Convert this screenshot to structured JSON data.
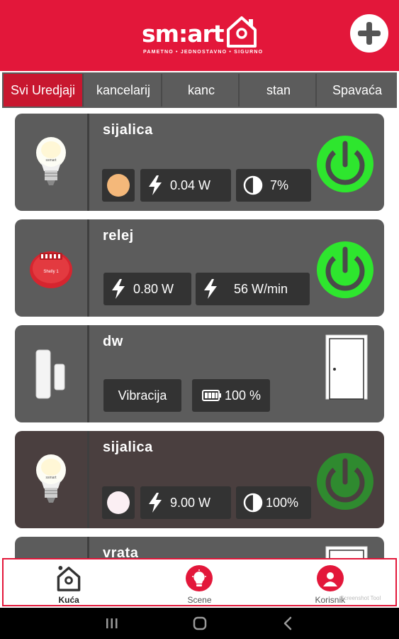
{
  "app": {
    "logo_text": "sm:art",
    "logo_tagline": "PAMETNO • JEDNOSTAVNO • SIGURNO",
    "add_icon": "plus-icon"
  },
  "tabs": [
    {
      "label": "Svi Uredjaji",
      "active": true
    },
    {
      "label": "kancelarij",
      "active": false
    },
    {
      "label": "kanc",
      "active": false
    },
    {
      "label": "stan",
      "active": false
    },
    {
      "label": "Spavaća",
      "active": false
    }
  ],
  "devices": [
    {
      "name": "sijalica",
      "icon": "light-bulb-icon",
      "color": "#f4b87a",
      "power": "0.04 W",
      "brightness": "7%",
      "state": "on",
      "power_color": "#2ee62e"
    },
    {
      "name": "relej",
      "icon": "relay-module-icon",
      "power": "0.80 W",
      "energy": "56 W/min",
      "state": "on",
      "power_color": "#2ee62e"
    },
    {
      "name": "dw",
      "icon": "door-window-sensor-icon",
      "vibration": "Vibracija",
      "battery": "100 %",
      "door_icon": "door-closed-icon"
    },
    {
      "name": "sijalica",
      "icon": "light-bulb-icon",
      "color": "#fbeff3",
      "power": "9.00 W",
      "brightness": "100%",
      "state": "on-dim",
      "power_color": "#2f8a2f"
    },
    {
      "name": "vrata",
      "icon": "door-window-sensor-icon"
    }
  ],
  "bottom_nav": [
    {
      "label": "Kuća",
      "icon": "home-icon",
      "active": true
    },
    {
      "label": "Scene",
      "icon": "scene-bulb-icon",
      "active": false
    },
    {
      "label": "Korisnik",
      "icon": "user-icon",
      "active": false
    }
  ],
  "watermark": "Screenshot Tool",
  "colors": {
    "brand_red": "#e3173a",
    "tab_active": "#c8172f",
    "card_bg": "#5c5c5c",
    "chip_bg": "#333333",
    "power_on": "#2ee62e"
  }
}
